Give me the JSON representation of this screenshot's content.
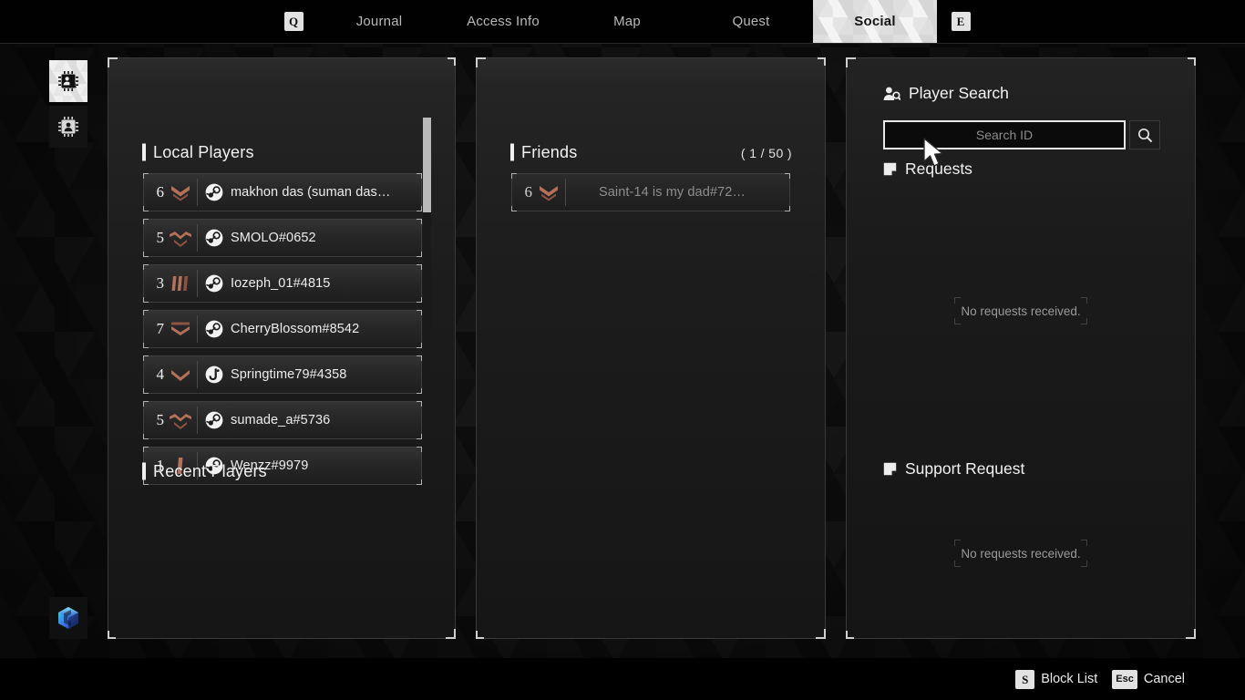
{
  "topnav": {
    "left_key": "Q",
    "right_key": "E",
    "tabs": [
      {
        "label": "Journal",
        "active": false
      },
      {
        "label": "Access Info",
        "active": false
      },
      {
        "label": "Map",
        "active": false
      },
      {
        "label": "Quest",
        "active": false
      },
      {
        "label": "Social",
        "active": true
      }
    ]
  },
  "rail": {
    "items": [
      {
        "icon": "chip-person-search-icon",
        "active": true
      },
      {
        "icon": "chip-person-icon",
        "active": false
      }
    ],
    "cube": {
      "icon": "cube-icon",
      "colors": [
        "#2fd2e8",
        "#3a6fe0",
        "#1a2f7a"
      ]
    }
  },
  "local_players": {
    "title": "Local Players",
    "recent_title": "Recent Players",
    "rows": [
      {
        "level": "6",
        "rank": "chevron-double-down",
        "platform": "steam-icon",
        "name": "makhon das (suman das…"
      },
      {
        "level": "5",
        "rank": "winged-chevron",
        "platform": "steam-icon",
        "name": "SMOLO#0652"
      },
      {
        "level": "3",
        "rank": "triple-bar",
        "platform": "steam-icon",
        "name": "Iozeph_01#4815"
      },
      {
        "level": "7",
        "rank": "chevron-bar-double",
        "platform": "steam-icon",
        "name": "CherryBlossom#8542"
      },
      {
        "level": "4",
        "rank": "chevron-single",
        "platform": "epic-icon",
        "name": "Springtime79#4358"
      },
      {
        "level": "5",
        "rank": "winged-chevron",
        "platform": "steam-icon",
        "name": "sumade_a#5736"
      },
      {
        "level": "1",
        "rank": "single-bar",
        "platform": "steam-icon",
        "name": "Wenzz#9979"
      }
    ]
  },
  "friends": {
    "title": "Friends",
    "count": "( 1 / 50 )",
    "rows": [
      {
        "level": "6",
        "rank": "chevron-double-down",
        "platform": "none",
        "name": "Saint-14 is my dad#72…",
        "offline": true
      }
    ]
  },
  "player_search": {
    "title": "Player Search",
    "search_placeholder": "Search ID",
    "search_value": "",
    "requests_title": "Requests",
    "requests_empty": "No requests received.",
    "support_title": "Support Request",
    "support_empty": "No requests received."
  },
  "bottombar": {
    "actions": [
      {
        "key": "S",
        "label": "Block List"
      },
      {
        "key": "Esc",
        "label": "Cancel"
      }
    ]
  },
  "colors": {
    "rank_copper": "#b5705a",
    "accent_white": "#f0f0f0",
    "panel_bg": "#1c1c1c"
  }
}
